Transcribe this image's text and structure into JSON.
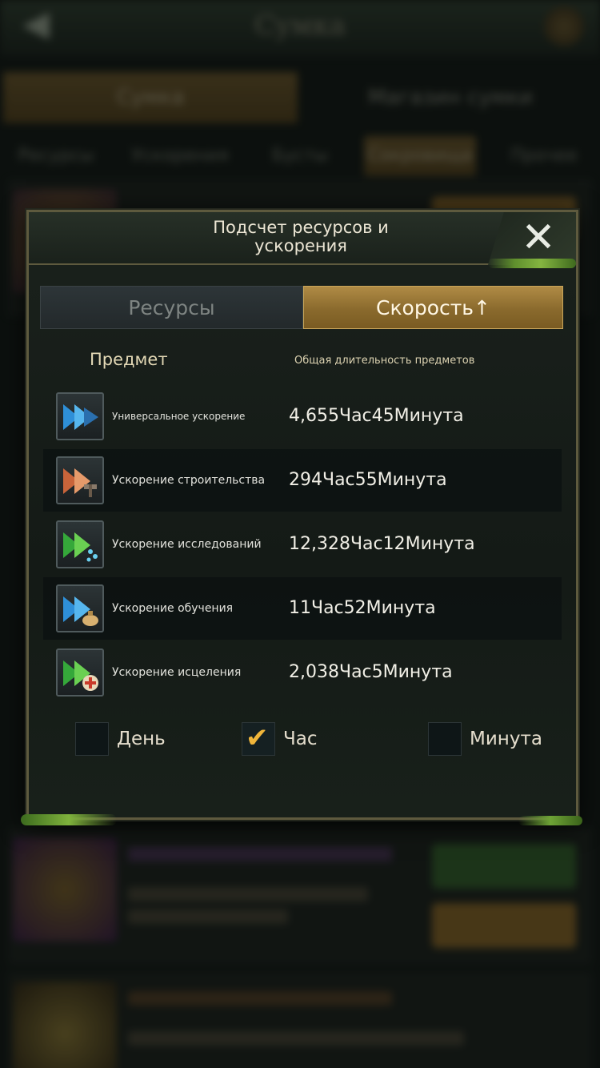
{
  "background": {
    "title": "Сумка",
    "tabs": [
      "Сумка",
      "Магазин сумки"
    ],
    "subtabs": [
      "Ресурсы",
      "Ускорения",
      "Бусты",
      "Сокровища",
      "Прочее"
    ]
  },
  "dialog": {
    "title_line1": "Подсчет ресурсов и",
    "title_line2": "ускорения",
    "close_icon": "close-x-icon",
    "tabs": {
      "resources": "Ресурсы",
      "speedups": "Скорость↑",
      "active": "speedups"
    },
    "columns": {
      "item": "Предмет",
      "total": "Общая длительность предметов"
    },
    "items": [
      {
        "name": "Универсальное ускорение",
        "total": "4,655Час45Минута",
        "icon": "universal-speedup-icon",
        "color": "#3aa0e0"
      },
      {
        "name": "Ускорение строительства",
        "total": "294Час55Минута",
        "icon": "construction-speedup-icon",
        "color": "#d07a4a"
      },
      {
        "name": "Ускорение исследований",
        "total": "12,328Час12Минута",
        "icon": "research-speedup-icon",
        "color": "#4cc04a"
      },
      {
        "name": "Ускорение обучения",
        "total": "11Час52Минута",
        "icon": "training-speedup-icon",
        "color": "#3aa0e0"
      },
      {
        "name": "Ускорение исцеления",
        "total": "2,038Час5Минута",
        "icon": "healing-speedup-icon",
        "color": "#4cc04a"
      }
    ],
    "units": [
      {
        "label": "День",
        "checked": false
      },
      {
        "label": "Час",
        "checked": true
      },
      {
        "label": "Минута",
        "checked": false
      }
    ]
  }
}
